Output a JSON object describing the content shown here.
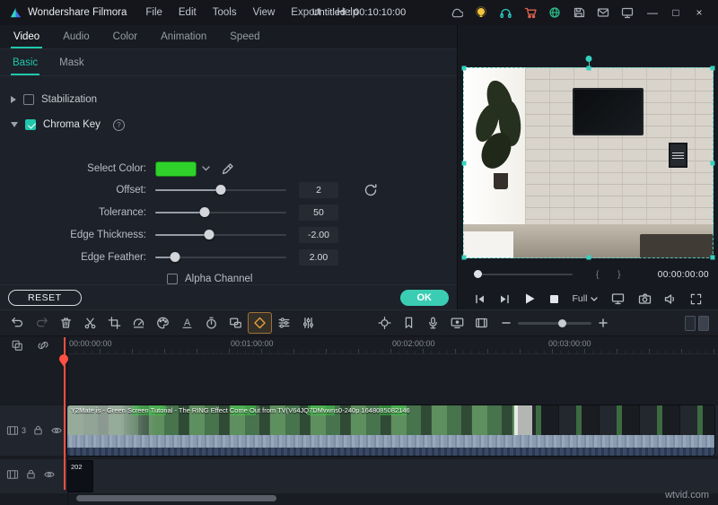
{
  "titlebar": {
    "app_name": "Wondershare Filmora",
    "menus": [
      "File",
      "Edit",
      "Tools",
      "View",
      "Export",
      "Help"
    ],
    "title": "Untitled : 00:10:10:00",
    "window_controls": {
      "minimize": "—",
      "maximize": "□",
      "close": "×"
    }
  },
  "tabs": {
    "items": [
      "Video",
      "Audio",
      "Color",
      "Animation",
      "Speed"
    ],
    "active": "Video"
  },
  "subtabs": {
    "items": [
      "Basic",
      "Mask"
    ],
    "active": "Basic"
  },
  "properties": {
    "stabilization": {
      "label": "Stabilization",
      "checked": false
    },
    "chroma_key": {
      "label": "Chroma Key",
      "checked": true,
      "help_icon": "?"
    },
    "select_color": {
      "label": "Select Color:",
      "color": "#2ed22a"
    },
    "sliders": [
      {
        "label": "Offset:",
        "value": "2",
        "percent": 50
      },
      {
        "label": "Tolerance:",
        "value": "50",
        "percent": 38
      },
      {
        "label": "Edge Thickness:",
        "value": "-2.00",
        "percent": 41
      },
      {
        "label": "Edge Feather:",
        "value": "2.00",
        "percent": 15
      }
    ],
    "alpha_channel": {
      "label": "Alpha Channel",
      "checked": false
    },
    "reset_label": "RESET",
    "ok_label": "OK"
  },
  "preview": {
    "timecode": "00:00:00:00",
    "braces": "{ }",
    "quality_label": "Full"
  },
  "timeline": {
    "ruler_labels": [
      "00:00:00:00",
      "00:01:00:00",
      "00:02:00:00",
      "00:03:00:00"
    ],
    "track1_badge": "3",
    "clip1_label": "Y2Mate is - Green Screen Tutorial - The RING Effect Come Out from TV(V64JQ7DMvwns0-240p 1648085082146",
    "clip2_label": "202"
  },
  "watermark": "wtvid.com",
  "colors": {
    "accent": "#1fc7ad",
    "keyframe": "#e8a33d",
    "playhead": "#ff5043",
    "select_green": "#2ed22a"
  }
}
